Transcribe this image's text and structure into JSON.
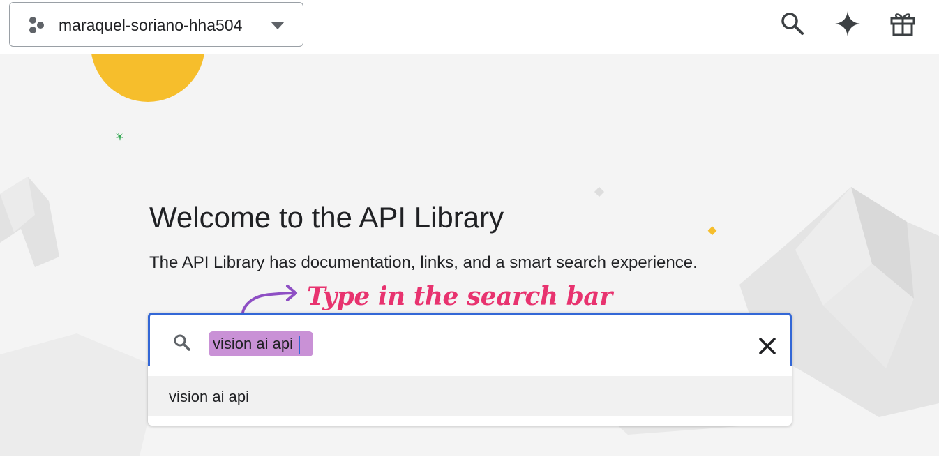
{
  "header": {
    "project_name": "maraquel-soriano-hha504",
    "icons": [
      "hexagon-cluster-icon",
      "chevron-down-icon",
      "search-icon",
      "sparkle-icon",
      "gift-icon"
    ]
  },
  "hero": {
    "title": "Welcome to the API Library",
    "subtitle": "The API Library has documentation, links, and a smart search experience.",
    "annotation": "Type in the search bar"
  },
  "search": {
    "value": "vision ai api",
    "suggestions": [
      "vision ai api"
    ]
  },
  "colors": {
    "accent_blue": "#3367d6",
    "highlight_purple": "#c991d6",
    "annotation_pink": "#e8336f",
    "sun_yellow": "#f6be2c"
  }
}
